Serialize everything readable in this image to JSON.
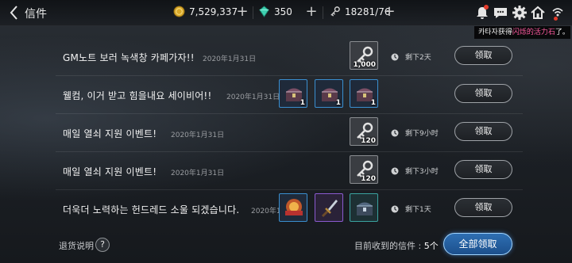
{
  "header": {
    "title": "信件",
    "gold": "7,529,337",
    "crystal": "350",
    "keys": "18281/76"
  },
  "toast": {
    "prefix": "카타자获得",
    "highlight": "闪烁的活力石",
    "suffix": "了。"
  },
  "mails": [
    {
      "subject": "GM노트 보러 녹색창 카페가자!!",
      "date": "2020年1月31日",
      "items": [
        {
          "icon": "key-icon",
          "rarity": "gray",
          "qty": "1,000"
        }
      ],
      "time_left": "剩下2天",
      "claim_label": "领取"
    },
    {
      "subject": "웰컴, 이거 받고 힘을내요 세이비어!!",
      "date": "2020年1月31日",
      "items": [
        {
          "icon": "chest-icon",
          "rarity": "blue",
          "qty": "1"
        },
        {
          "icon": "chest-icon",
          "rarity": "blue",
          "qty": "1"
        },
        {
          "icon": "chest-icon",
          "rarity": "blue",
          "qty": "1"
        }
      ],
      "time_left": "",
      "claim_label": "领取"
    },
    {
      "subject": "매일 열쇠 지원 이벤트!",
      "date": "2020年1月31日",
      "items": [
        {
          "icon": "key-icon",
          "rarity": "gray",
          "qty": "120"
        }
      ],
      "time_left": "剩下9小时",
      "claim_label": "领取"
    },
    {
      "subject": "매일 열쇠 지원 이벤트!",
      "date": "2020年1月31日",
      "items": [
        {
          "icon": "key-icon",
          "rarity": "gray",
          "qty": "120"
        }
      ],
      "time_left": "剩下3小时",
      "claim_label": "领取"
    },
    {
      "subject": "더욱더 노력하는 헌드레드 소울 되겠습니다.",
      "date": "2020年1",
      "items": [
        {
          "icon": "orb-icon",
          "rarity": "blue",
          "qty": ""
        },
        {
          "icon": "dagger-icon",
          "rarity": "purple",
          "qty": ""
        },
        {
          "icon": "chest-icon",
          "rarity": "teal",
          "qty": ""
        }
      ],
      "time_left": "剩下1天",
      "claim_label": "领取"
    }
  ],
  "footer": {
    "refund_label": "退货说明",
    "help_glyph": "?",
    "count_label": "目前收到的信件 : ",
    "count_value": "5个",
    "claim_all_label": "全部领取"
  },
  "colors": {
    "accent": "#2e6fb3",
    "rarity_blue": "#3a8fd0",
    "rarity_purple": "#8b5ad0",
    "rarity_teal": "#3aa3a0",
    "notification": "#e23b2b",
    "highlight": "#ff5aa0"
  }
}
